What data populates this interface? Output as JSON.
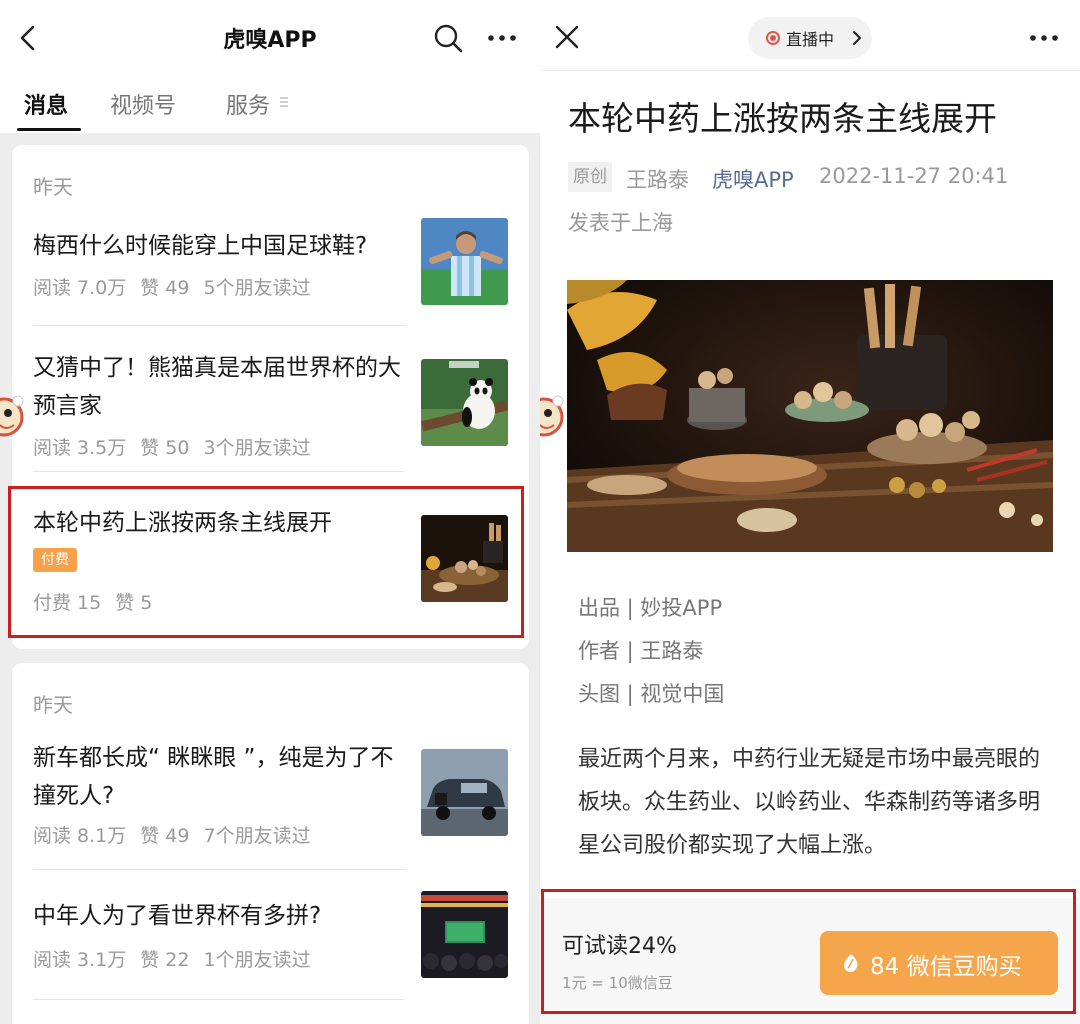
{
  "left": {
    "title": "虎嗅APP",
    "tabs": [
      {
        "label": "消息"
      },
      {
        "label": "视频号"
      },
      {
        "label": "服务"
      }
    ],
    "groups": [
      {
        "date": "昨天",
        "items": [
          {
            "title": "梅西什么时候能穿上中国足球鞋?",
            "read": "阅读 7.0万",
            "likes": "赞 49",
            "friends": "5个朋友读过",
            "thumb": "soccer-player"
          },
          {
            "title": "又猜中了！熊猫真是本届世界杯的大预言家",
            "read": "阅读 3.5万",
            "likes": "赞 50",
            "friends": "3个朋友读过",
            "thumb": "panda"
          },
          {
            "title": "本轮中药上涨按两条主线展开",
            "badge": "付费",
            "paid": "付费 15",
            "likes": "赞 5",
            "thumb": "herbs"
          }
        ]
      },
      {
        "date": "昨天",
        "items": [
          {
            "title": "新车都长成“ 眯眯眼 ”，纯是为了不撞死人?",
            "read": "阅读 8.1万",
            "likes": "赞 49",
            "friends": "7个朋友读过",
            "thumb": "car"
          },
          {
            "title": "中年人为了看世界杯有多拼?",
            "read": "阅读 3.1万",
            "likes": "赞 22",
            "friends": "1个朋友读过",
            "thumb": "crowd"
          }
        ]
      }
    ]
  },
  "right": {
    "live_label": "直播中",
    "article": {
      "title": "本轮中药上涨按两条主线展开",
      "original_badge": "原创",
      "author": "王路泰",
      "account": "虎嗅APP",
      "datetime": "2022-11-27 20:41",
      "location": "发表于上海",
      "credits": [
        "出品 | 妙投APP",
        "作者 | 王路泰",
        "头图 | 视觉中国"
      ],
      "body": "最近两个月来，中药行业无疑是市场中最亮眼的板块。众生药业、以岭药业、华森制药等诸多明星公司股价都实现了大幅上涨。"
    },
    "paywall": {
      "trial": "可试读24%",
      "rate": "1元 = 10微信豆",
      "buy_label": "84 微信豆购买"
    }
  },
  "colors": {
    "accent_orange": "#f5a54a",
    "highlight_red": "#c9201f",
    "link_blue": "#576b95"
  }
}
